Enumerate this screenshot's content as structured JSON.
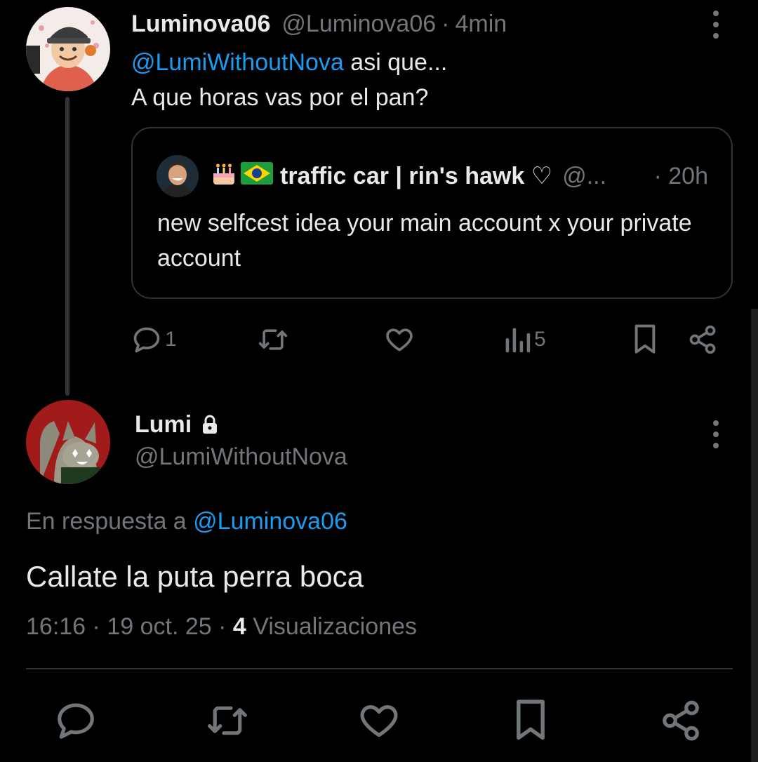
{
  "parent_tweet": {
    "display_name": "Luminova06",
    "handle": "@Luminova06",
    "separator": "·",
    "time": "4min",
    "mention": "@LumiWithoutNova",
    "text_after_mention": " asi que...",
    "text_line2": "A que horas vas por el pan?",
    "quoted": {
      "emojis": "🎂🇧🇷",
      "display_name": "traffic car | rin's hawk ♡",
      "handle": "@...",
      "separator": "·",
      "time": "20h",
      "text": "new selfcest idea your main account x your private account"
    },
    "actions": {
      "reply_count": "1",
      "views_count": "5",
      "icons": [
        "reply-icon",
        "retweet-icon",
        "like-icon",
        "views-icon",
        "bookmark-icon",
        "share-icon"
      ]
    }
  },
  "reply_tweet": {
    "display_name": "Lumi",
    "locked_icon": "lock-icon",
    "handle": "@LumiWithoutNova",
    "replying_prefix": "En respuesta a ",
    "replying_to": "@Luminova06",
    "text": "Callate la puta perra boca",
    "time": "16:16",
    "date": "19 oct. 25",
    "separator": "·",
    "views_count": "4",
    "views_label": "Visualizaciones",
    "icons": [
      "reply-icon",
      "retweet-icon",
      "like-icon",
      "bookmark-icon",
      "share-icon"
    ]
  },
  "colors": {
    "background": "#000000",
    "text": "#e7e9ea",
    "muted": "#71767b",
    "link": "#1d9bf0",
    "border": "#2f3336"
  }
}
